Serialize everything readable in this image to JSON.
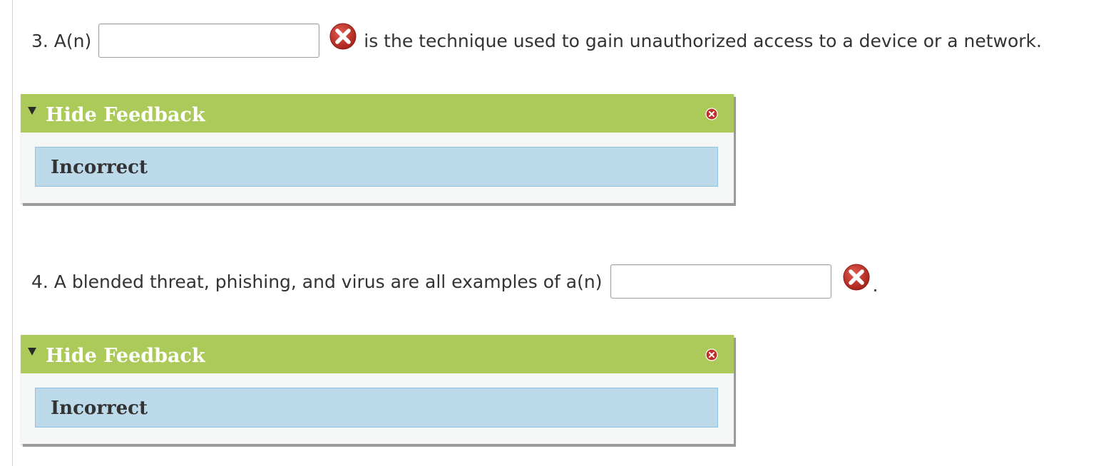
{
  "questions": [
    {
      "prefix": "3. A(n)",
      "answer_value": "",
      "suffix": "is the technique used to gain unauthorized access to a device or a network.",
      "status_icon": "incorrect-x-icon",
      "feedback": {
        "toggle_label": "Hide Feedback",
        "result": "Incorrect"
      }
    },
    {
      "prefix": "4. A blended threat, phishing, and virus are all examples of a(n)",
      "answer_value": "",
      "suffix": ".",
      "status_icon": "incorrect-x-icon",
      "feedback": {
        "toggle_label": "Hide Feedback",
        "result": "Incorrect"
      }
    }
  ],
  "colors": {
    "feedback_header": "#abca5a",
    "feedback_body": "#bddaea",
    "feedback_body_border": "#8fc2de",
    "incorrect_icon": "#c0302a"
  }
}
